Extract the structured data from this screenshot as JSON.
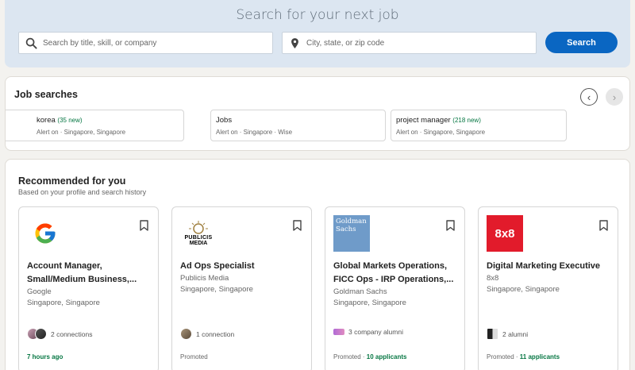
{
  "search": {
    "title": "Search for your next job",
    "keyword_placeholder": "Search by title, skill, or company",
    "location_placeholder": "City, state, or zip code",
    "button_label": "Search"
  },
  "job_searches": {
    "title": "Job searches",
    "prev_icon": "‹",
    "next_icon": "›",
    "items": [
      {
        "name": "korea",
        "new": "(35 new)",
        "sub": "Alert on · Singapore, Singapore"
      },
      {
        "name": "Jobs",
        "new": "",
        "sub": "Alert on · Singapore · Wise"
      },
      {
        "name": "project manager",
        "new": "(218 new)",
        "sub": "Alert on · Singapore, Singapore"
      }
    ]
  },
  "recommended": {
    "title": "Recommended for you",
    "subtitle": "Based on your profile and search history",
    "jobs": [
      {
        "title_line1": "Account Manager,",
        "title_line2": "Small/Medium Business,...",
        "company": "Google",
        "location": "Singapore, Singapore",
        "insight": "2 connections",
        "foot_label": "7 hours ago",
        "foot_extra": ""
      },
      {
        "title_line1": "Ad Ops Specialist",
        "title_line2": "",
        "company": "Publicis Media",
        "location": "Singapore, Singapore",
        "insight": "1 connection",
        "foot_label": "Promoted",
        "foot_extra": "",
        "logo_text_1": "PUBLICIS",
        "logo_text_2": "MEDIA"
      },
      {
        "title_line1": "Global Markets Operations,",
        "title_line2": "FICC Ops - IRP Operations,...",
        "company": "Goldman Sachs",
        "location": "Singapore, Singapore",
        "insight": "3 company alumni",
        "foot_label": "Promoted · ",
        "foot_extra": "10 applicants",
        "logo_text_1": "Goldman",
        "logo_text_2": "Sachs"
      },
      {
        "title_line1": "Digital Marketing Executive",
        "title_line2": "",
        "company": "8x8",
        "location": "Singapore, Singapore",
        "insight": "2 alumni",
        "foot_label": "Promoted · ",
        "foot_extra": "11 applicants",
        "logo_text_1": "8x8"
      }
    ]
  },
  "colors": {
    "brand_blue": "#0a66c2",
    "success_green": "#057642",
    "hero_bg": "#dce6f1"
  }
}
